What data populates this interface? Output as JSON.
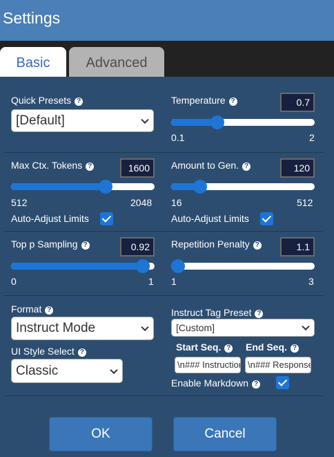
{
  "window": {
    "title": "Settings"
  },
  "tabs": [
    {
      "label": "Basic",
      "active": true
    },
    {
      "label": "Advanced",
      "active": false
    }
  ],
  "quick_presets": {
    "label": "Quick Presets",
    "value": "[Default]"
  },
  "temperature": {
    "label": "Temperature",
    "value": "0.7",
    "min": "0.1",
    "max": "2",
    "level": 0.32
  },
  "max_ctx": {
    "label": "Max Ctx. Tokens",
    "value": "1600",
    "min": "512",
    "max": "2048",
    "level": 0.66
  },
  "amount_gen": {
    "label": "Amount to Gen.",
    "value": "120",
    "min": "16",
    "max": "512",
    "level": 0.2
  },
  "auto_adjust_left": {
    "label": "Auto-Adjust Limits",
    "checked": true
  },
  "auto_adjust_right": {
    "label": "Auto-Adjust Limits",
    "checked": true
  },
  "top_p": {
    "label": "Top p Sampling",
    "value": "0.92",
    "min": "0",
    "max": "1",
    "level": 0.92
  },
  "rep_pen": {
    "label": "Repetition Penalty",
    "value": "1.1",
    "min": "1",
    "max": "3",
    "level": 0.05
  },
  "format": {
    "label": "Format",
    "value": "Instruct Mode"
  },
  "ui_style": {
    "label": "UI Style Select",
    "value": "Classic"
  },
  "instruct_tag": {
    "label": "Instruct Tag Preset",
    "value": "[Custom]"
  },
  "start_seq": {
    "label": "Start Seq.",
    "value": "\\n### Instruction:\\n"
  },
  "end_seq": {
    "label": "End Seq.",
    "value": "\\n### Response:\\n"
  },
  "enable_markdown": {
    "label": "Enable Markdown",
    "checked": true
  },
  "buttons": {
    "ok": "OK",
    "cancel": "Cancel"
  },
  "colors": {
    "background": "#2d4d70",
    "titlebar": "#4a7fb7",
    "accent": "#1d75d6",
    "numbox": "#18203f"
  },
  "icons": {
    "help": "question-circle-icon",
    "dropdown": "chevron-down-icon",
    "check": "checkmark-icon"
  }
}
